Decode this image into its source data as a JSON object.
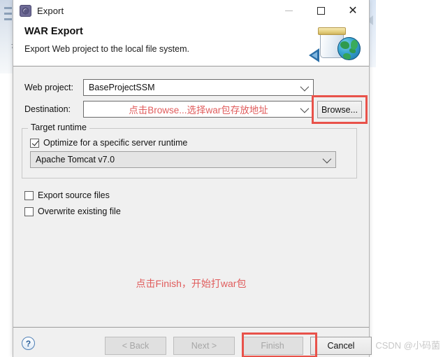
{
  "window": {
    "title": "Export",
    "title_icon": "export-gear-icon",
    "controls": {
      "minimize": "minimize-icon",
      "maximize": "maximize-icon",
      "close": "close-icon"
    }
  },
  "header": {
    "title": "WAR Export",
    "description": "Export Web project to the local file system.",
    "icon": "war-jar-globe-icon"
  },
  "form": {
    "web_project": {
      "label": "Web project:",
      "value": "BaseProjectSSM"
    },
    "destination": {
      "label": "Destination:",
      "value": "点击Browse...选择war包存放地址",
      "placeholder": ""
    },
    "browse_button": "Browse..."
  },
  "target_runtime": {
    "legend": "Target runtime",
    "optimize_checkbox": {
      "label": "Optimize for a specific server runtime",
      "checked": true
    },
    "runtime_value": "Apache Tomcat v7.0"
  },
  "options": [
    {
      "label": "Export source files",
      "checked": false
    },
    {
      "label": "Overwrite existing file",
      "checked": false
    }
  ],
  "annotations": {
    "destination_hint": "点击Browse...选择war包存放地址",
    "finish_hint": "点击Finish，开始打war包",
    "highlight_color": "#e8524a",
    "text_color": "#e05c5c"
  },
  "footer": {
    "help": "?",
    "buttons": [
      {
        "label": "< Back",
        "disabled": true
      },
      {
        "label": "Next >",
        "disabled": true
      },
      {
        "label": "Finish",
        "disabled": true
      },
      {
        "label": "Cancel",
        "disabled": false
      }
    ]
  },
  "watermark": "CSDN @小码菌"
}
